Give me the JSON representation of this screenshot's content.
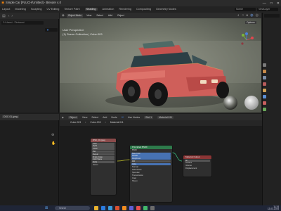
{
  "window": {
    "title": "Simple Car [PLUCH/Untitled] - Blender 4.0",
    "controls": [
      "—",
      "□",
      "✕"
    ]
  },
  "menubar": {
    "items": [
      "Layout",
      "Modeling",
      "Sculpting",
      "UV Editing",
      "Texture Paint",
      "Shading",
      "Animation",
      "Rendering",
      "Compositing",
      "Geometry Nodes",
      "Scripting"
    ],
    "active": "Shading",
    "scene": "Scene",
    "view_layer": "ViewLayer"
  },
  "file_browser": {
    "path": "C:\\Users\\...\\Textures\\",
    "filter_icon": "filter-icon"
  },
  "viewport": {
    "mode": "Object Mode",
    "menus": [
      "View",
      "Select",
      "Add",
      "Object"
    ],
    "overlay_title": "User Perspective",
    "overlay_subtitle": "(1) Scene Collection | Cube.003",
    "options_label": "Options"
  },
  "node_editor": {
    "editor_type": "Object",
    "menus": [
      "View",
      "Select",
      "Add",
      "Node"
    ],
    "use_nodes_label": "Use Nodes",
    "slot": "Slot 1",
    "material": "Material.011",
    "breadcrumb": [
      "Cube.003",
      "Cube.003",
      "Material.011"
    ],
    "nodes": {
      "image_texture": {
        "title": "DSC_01.jpeg",
        "fields": [
          "Color",
          "Alpha",
          "Linear",
          "Flat",
          "Repeat",
          "Single Image",
          "Color Space",
          "Alpha",
          "Vector"
        ]
      },
      "principled": {
        "title": "Principled BSDF",
        "fields": [
          "BSDF",
          "Base Color",
          "Metallic",
          "Roughness",
          "IOR",
          "Alpha",
          "Normal",
          "Subsurface",
          "Specular",
          "Transmission",
          "Coat",
          "Sheen",
          "Emission"
        ]
      },
      "output": {
        "title": "Material Output",
        "fields": [
          "All",
          "Surface",
          "Volume",
          "Displacement"
        ]
      }
    }
  },
  "image_editor": {
    "image_name": "DSC 01.jpeg"
  },
  "taskbar": {
    "search_placeholder": "Search",
    "time": "11:24",
    "date": "12-03-2024"
  }
}
